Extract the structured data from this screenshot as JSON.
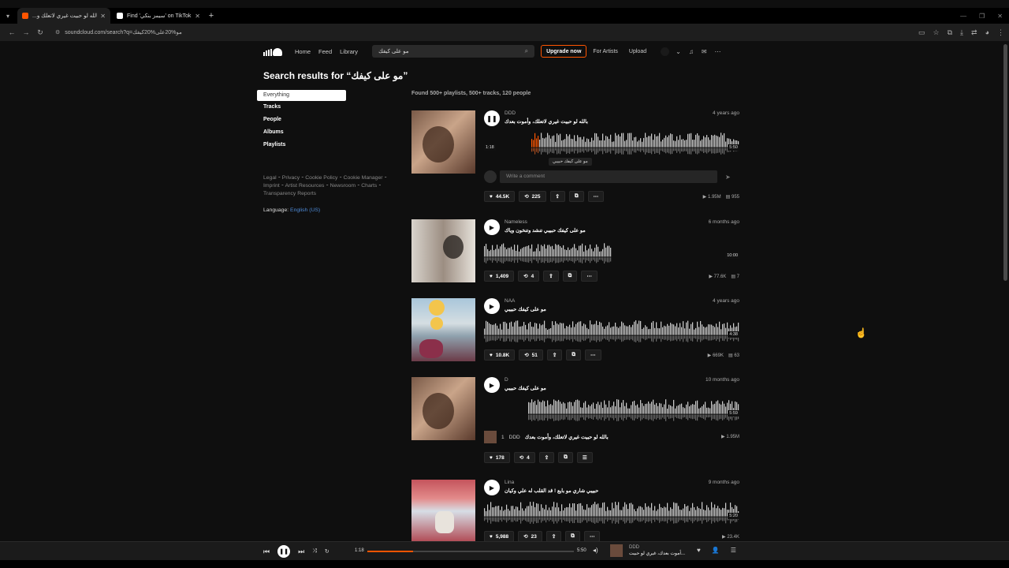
{
  "browser": {
    "tabs": [
      {
        "title": "...ﺑﺎﻟﻠﻪ ﻟﻮ ﺣﺒﻴﺖ ﻏﻴﺮﻱ ﻻﺗﻌﻠﻚ ﻭ",
        "favicon": "soundcloud-icon",
        "color": "#ff5500",
        "active": true
      },
      {
        "title": "Find 'ﺳﻴﻤﺰ ﺑﻨﻜﻲ' on TikTok | Ti",
        "favicon": "tiktok-icon",
        "color": "#ffffff",
        "active": false
      }
    ],
    "url": "soundcloud.com/search?q=ﻣﻮ%20ﻋﻠﻰ%20ﻛﻴﻔﻚ"
  },
  "header": {
    "nav": [
      "Home",
      "Feed",
      "Library"
    ],
    "search_value": "ﻣﻮ ﻋﻠﻰ ﻛﻴﻔﻚ",
    "upgrade": "Upgrade now",
    "for_artists": "For Artists",
    "upload": "Upload"
  },
  "search": {
    "title": "Search results for “ﻣﻮ ﻋﻠﻰ ﻛﻴﻔﻚ”",
    "filters": [
      "Everything",
      "Tracks",
      "People",
      "Albums",
      "Playlists"
    ],
    "active_filter": "Everything",
    "found": "Found 500+ playlists, 500+ tracks, 120 people"
  },
  "sidebar_footer": {
    "links": "Legal ⁃ Privacy ⁃ Cookie Policy ⁃ Cookie Manager ⁃ Imprint ⁃ Artist Resources ⁃ Newsroom ⁃ Charts ⁃ Transparency Reports",
    "language_label": "Language:",
    "language_value": "English (US)"
  },
  "tracks": [
    {
      "user": "DDD",
      "title": "ﺑﺎﻟﻠﻪ ﻟﻮ ﺣﺒﻴﺖ ﻏﻴﺮﻱ ﻻﺗﻌﻠﻚ، ﻭﺃﻣﻮﺕ ﺑﻌﺪﻙ",
      "date": "4 years ago",
      "likes": "44.5K",
      "reposts": "225",
      "plays": "1.95M",
      "comments": "955",
      "elapsed": "1:18",
      "duration": "5:50",
      "comment_placeholder": "Write a comment",
      "tooltip": "ﻣﻮ ﻋﻠﻰ ﻛﻴﻔﻚ ﺣﺒﻴﺒﻲ"
    },
    {
      "user": "Nameless",
      "title": "ﻣﻮ ﻋﻠﻰ ﻛﻴﻔﻚ ﺣﺒﻴﺒﻲ ﺗﻨﺸﺪ ﻭﺗﻨﺨﻮﻥ ﻭﻳﺎﻙ",
      "date": "6 months ago",
      "likes": "1,409",
      "reposts": "4",
      "plays": "77.6K",
      "comments": "7",
      "duration": "10:00"
    },
    {
      "user": "NAA",
      "title": "ﻣﻮ ﻋﻠﻰ ﻛﻴﻔﻚ ﺣﺒﻴﺒﻲ",
      "date": "4 years ago",
      "likes": "10.8K",
      "reposts": "51",
      "plays": "669K",
      "comments": "63",
      "duration": "4:38"
    },
    {
      "user": "D",
      "title": "ﻣﻮ ﻋﻠﻰ ﻛﻴﻔﻚ ﺣﺒﻴﺒﻲ",
      "date": "10 months ago",
      "likes": "178",
      "reposts": "4",
      "duration": "5:59",
      "playlist_index": "1",
      "playlist_user": "DDD",
      "playlist_title": "ﺑﺎﻟﻠﻪ ﻟﻮ ﺣﺒﻴﺖ ﻏﻴﺮﻱ ﻻﺗﻌﻠﻚ، ﻭﺃﻣﻮﺕ ﺑﻌﺪﻙ",
      "playlist_plays": "1.95M"
    },
    {
      "user": "Lina",
      "title": "ﺣﺒﻴﺒﻲ ﺷﺎﺭﻱ ﻣﻮ ﺑﺎﻳﻊ ! ﻗﺪ ﺍﻟﻘﻠﺐ ﻟﻪ ﻋﻠﻲ ﻭﻛﻴﺎﻥ",
      "date": "9 months ago",
      "likes": "5,988",
      "reposts": "23",
      "plays": "23.4K",
      "duration": "5:20"
    }
  ],
  "player": {
    "elapsed": "1:18",
    "duration": "5:50",
    "progress": 0.22,
    "user": "DDD",
    "title": "ﺃﻣﻮﺕ ﺑﻌﺪﻙ، ﻏﻴﺮﻱ ﻟﻮ ﺣﺒﻴﺖ..."
  },
  "colors": {
    "accent": "#ff5500",
    "link": "#4e8bd8"
  }
}
